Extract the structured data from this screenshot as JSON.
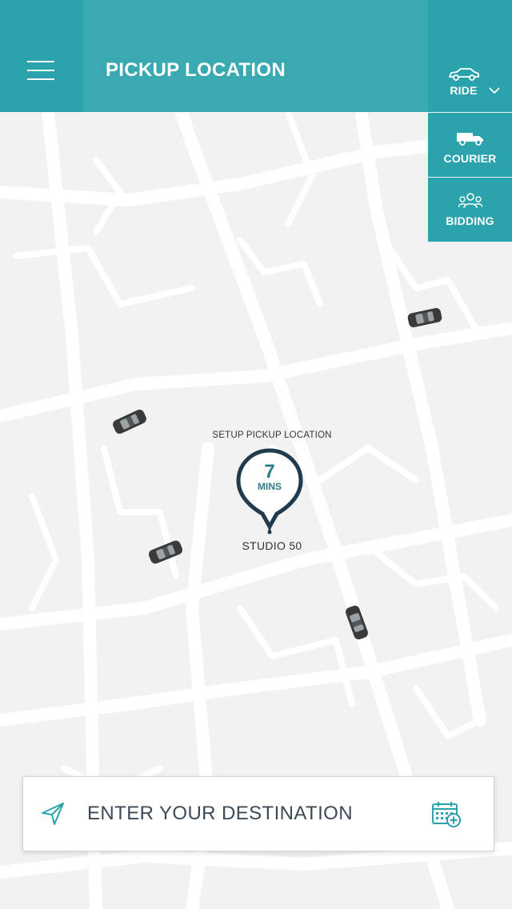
{
  "header": {
    "title": "PICKUP LOCATION",
    "menu_icon": "hamburger-menu-icon"
  },
  "modes": {
    "ride": {
      "label": "RIDE",
      "icon": "car-icon",
      "chevron": "chevron-down-icon"
    },
    "courier": {
      "label": "COURIER",
      "icon": "truck-icon"
    },
    "bidding": {
      "label": "BIDDING",
      "icon": "people-icon"
    }
  },
  "pin": {
    "caption": "SETUP PICKUP LOCATION",
    "eta_value": "7",
    "eta_unit": "MINS",
    "place": "STUDIO 50"
  },
  "destination": {
    "placeholder": "ENTER YOUR DESTINATION",
    "send_icon": "send-arrow-icon",
    "calendar_icon": "calendar-add-icon"
  },
  "colors": {
    "accent": "#2aa3ac",
    "pin_stroke": "#1f3b4d",
    "map_background": "#f2f2f2",
    "map_roads": "#ffffff"
  }
}
